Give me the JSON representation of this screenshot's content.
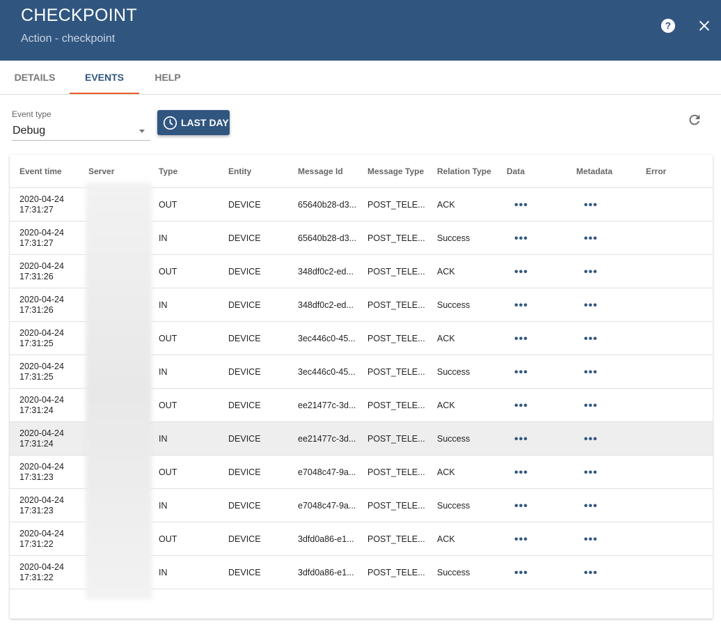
{
  "header": {
    "title": "CHECKPOINT",
    "subtitle": "Action - checkpoint",
    "icons": [
      "help-icon",
      "close-icon"
    ]
  },
  "tabs": [
    {
      "label": "DETAILS"
    },
    {
      "label": "EVENTS",
      "active": true
    },
    {
      "label": "HELP"
    }
  ],
  "filter": {
    "label": "Event type",
    "value": "Debug",
    "time_button": "LAST DAY"
  },
  "colors": {
    "primary": "#305680",
    "accent": "#e85c2a"
  },
  "table": {
    "columns": [
      "Event time",
      "Server",
      "Type",
      "Entity",
      "Message Id",
      "Message Type",
      "Relation Type",
      "Data",
      "Metadata",
      "Error"
    ],
    "rows": [
      {
        "date": "2020-04-24",
        "time": "17:31:27",
        "type": "OUT",
        "entity": "DEVICE",
        "msg_id": "65640b28-d3...",
        "msg_type": "POST_TELE...",
        "relation": "ACK"
      },
      {
        "date": "2020-04-24",
        "time": "17:31:27",
        "type": "IN",
        "entity": "DEVICE",
        "msg_id": "65640b28-d3...",
        "msg_type": "POST_TELE...",
        "relation": "Success"
      },
      {
        "date": "2020-04-24",
        "time": "17:31:26",
        "type": "OUT",
        "entity": "DEVICE",
        "msg_id": "348df0c2-ed...",
        "msg_type": "POST_TELE...",
        "relation": "ACK"
      },
      {
        "date": "2020-04-24",
        "time": "17:31:26",
        "type": "IN",
        "entity": "DEVICE",
        "msg_id": "348df0c2-ed...",
        "msg_type": "POST_TELE...",
        "relation": "Success"
      },
      {
        "date": "2020-04-24",
        "time": "17:31:25",
        "type": "OUT",
        "entity": "DEVICE",
        "msg_id": "3ec446c0-45...",
        "msg_type": "POST_TELE...",
        "relation": "ACK"
      },
      {
        "date": "2020-04-24",
        "time": "17:31:25",
        "type": "IN",
        "entity": "DEVICE",
        "msg_id": "3ec446c0-45...",
        "msg_type": "POST_TELE...",
        "relation": "Success"
      },
      {
        "date": "2020-04-24",
        "time": "17:31:24",
        "type": "OUT",
        "entity": "DEVICE",
        "msg_id": "ee21477c-3d...",
        "msg_type": "POST_TELE...",
        "relation": "ACK"
      },
      {
        "date": "2020-04-24",
        "time": "17:31:24",
        "type": "IN",
        "entity": "DEVICE",
        "msg_id": "ee21477c-3d...",
        "msg_type": "POST_TELE...",
        "relation": "Success",
        "highlighted": true
      },
      {
        "date": "2020-04-24",
        "time": "17:31:23",
        "type": "OUT",
        "entity": "DEVICE",
        "msg_id": "e7048c47-9a...",
        "msg_type": "POST_TELE...",
        "relation": "ACK"
      },
      {
        "date": "2020-04-24",
        "time": "17:31:23",
        "type": "IN",
        "entity": "DEVICE",
        "msg_id": "e7048c47-9a...",
        "msg_type": "POST_TELE...",
        "relation": "Success"
      },
      {
        "date": "2020-04-24",
        "time": "17:31:22",
        "type": "OUT",
        "entity": "DEVICE",
        "msg_id": "3dfd0a86-e1...",
        "msg_type": "POST_TELE...",
        "relation": "ACK"
      },
      {
        "date": "2020-04-24",
        "time": "17:31:22",
        "type": "IN",
        "entity": "DEVICE",
        "msg_id": "3dfd0a86-e1...",
        "msg_type": "POST_TELE...",
        "relation": "Success"
      }
    ],
    "more_glyph": "•••"
  }
}
